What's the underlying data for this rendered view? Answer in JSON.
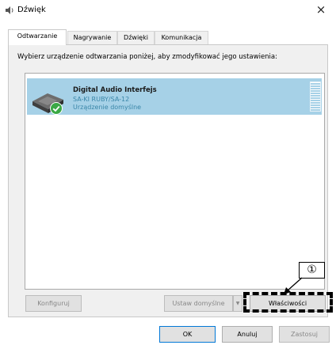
{
  "window": {
    "title": "Dźwięk",
    "close_label": "×"
  },
  "tabs": [
    {
      "label": "Odtwarzanie",
      "active": true
    },
    {
      "label": "Nagrywanie",
      "active": false
    },
    {
      "label": "Dźwięki",
      "active": false
    },
    {
      "label": "Komunikacja",
      "active": false
    }
  ],
  "main": {
    "instruction": "Wybierz urządzenie odtwarzania poniżej, aby zmodyfikować jego ustawienia:"
  },
  "device": {
    "name": "Digital Audio Interfejs",
    "subtitle": "SA-KI RUBY/SA-12",
    "status": "Urządzenie domyślne",
    "icon": "speaker-device-icon",
    "default_badge_icon": "checkmark-icon"
  },
  "buttons": {
    "configure": "Konfiguruj",
    "set_default": "Ustaw domyślne",
    "properties": "Właściwości",
    "ok": "OK",
    "cancel": "Anuluj",
    "apply": "Zastosuj"
  },
  "annotation": {
    "label": "①"
  },
  "colors": {
    "selection": "#a6d1e7",
    "device_text": "#3a86a8",
    "accent_border": "#0078d7",
    "check_green": "#3aa845"
  }
}
